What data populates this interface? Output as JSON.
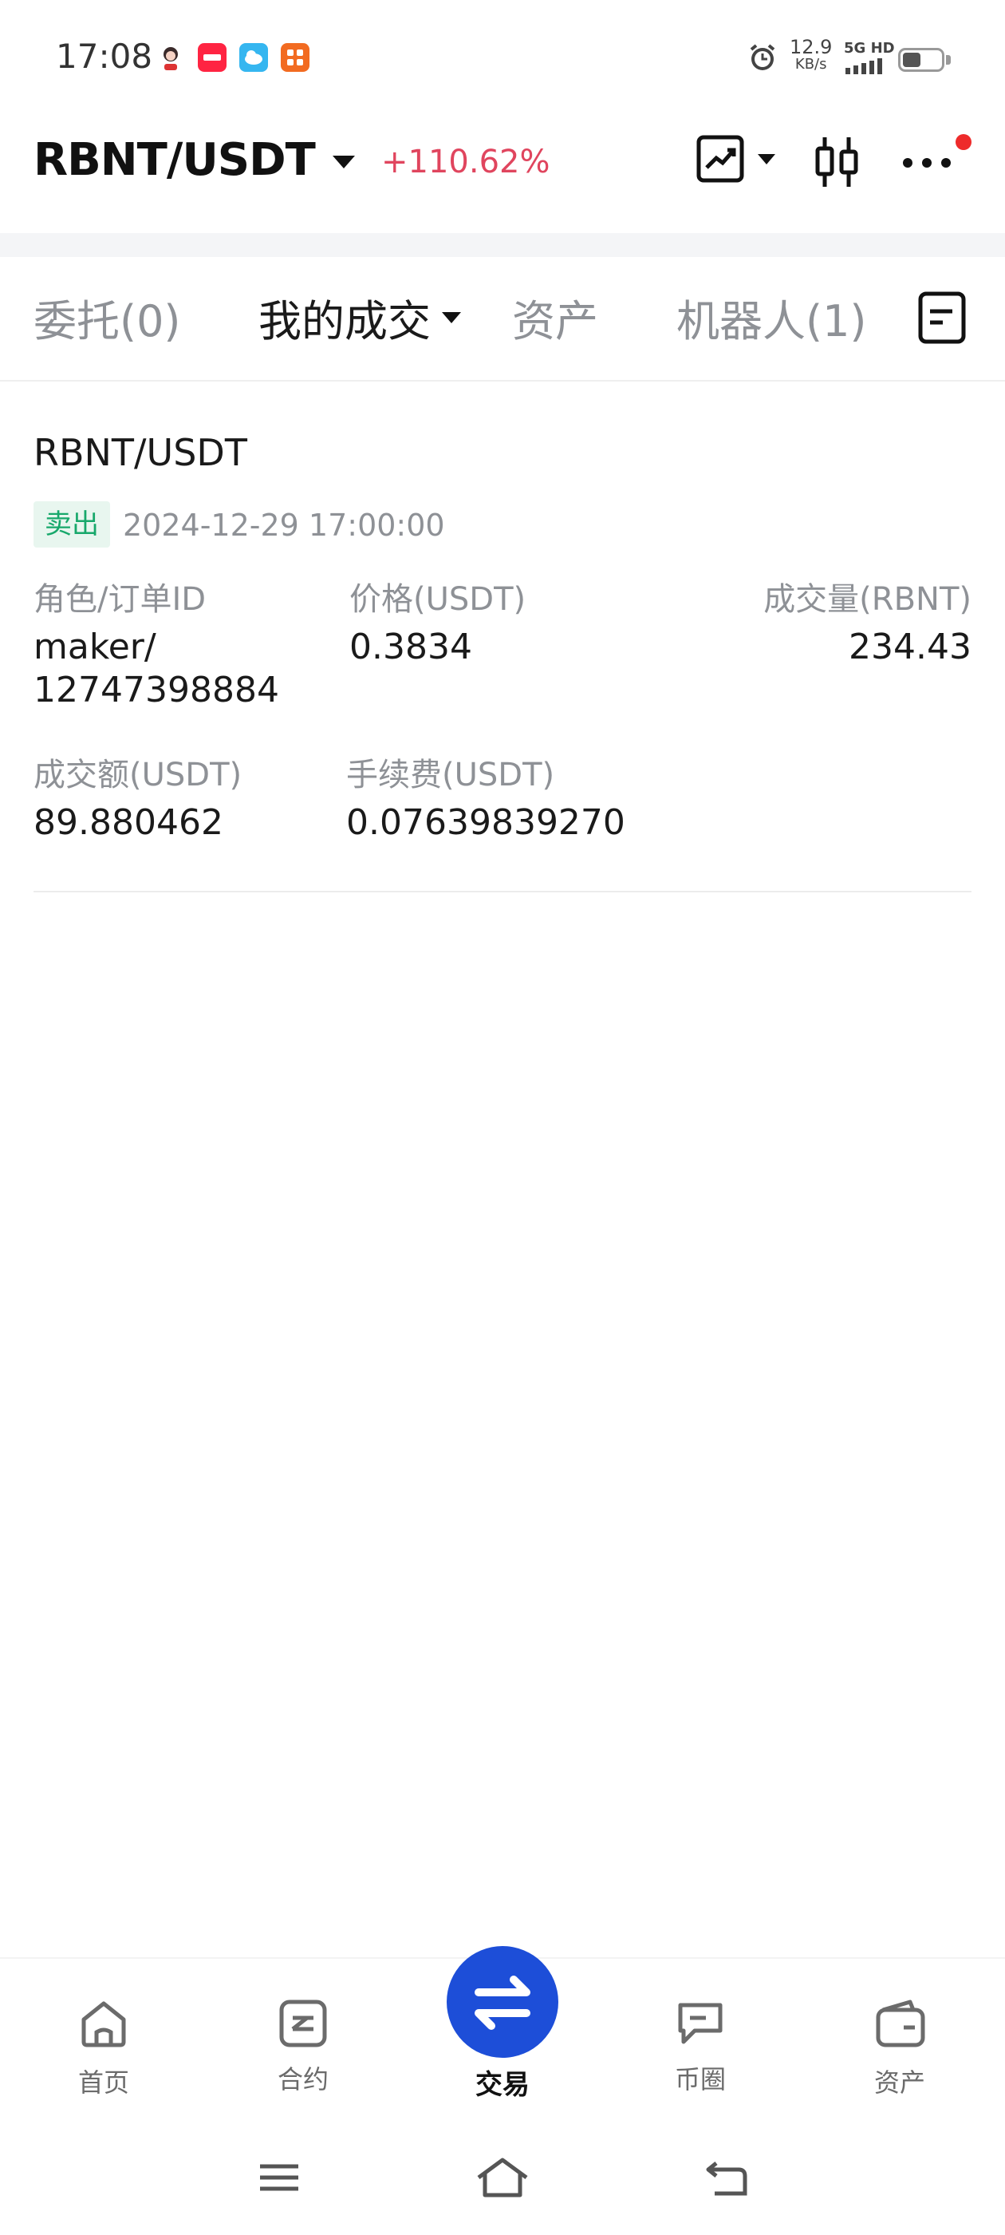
{
  "status_bar": {
    "time": "17:08",
    "net_speed_value": "12.9",
    "net_speed_unit": "KB/s",
    "network": "5G HD"
  },
  "header": {
    "pair": "RBNT/USDT",
    "change": "+110.62%"
  },
  "tabs": [
    {
      "label": "委托(0)",
      "active": false
    },
    {
      "label": "我的成交",
      "active": true
    },
    {
      "label": "资产",
      "active": false
    },
    {
      "label": "机器人(1)",
      "active": false
    }
  ],
  "trade": {
    "pair": "RBNT/USDT",
    "side": "卖出",
    "datetime": "2024-12-29 17:00:00",
    "role_label": "角色/订单ID",
    "role_value_line1": "maker/",
    "role_value_line2": "12747398884",
    "price_label": "价格(USDT)",
    "price_value": "0.3834",
    "volume_label": "成交量(RBNT)",
    "volume_value": "234.43",
    "amount_label": "成交额(USDT)",
    "amount_value": "89.880462",
    "fee_label": "手续费(USDT)",
    "fee_value": "0.07639839270"
  },
  "bottom_nav": [
    {
      "label": "首页",
      "icon": "home-icon"
    },
    {
      "label": "合约",
      "icon": "contract-icon"
    },
    {
      "label": "交易",
      "icon": "swap-icon",
      "active": true
    },
    {
      "label": "币圈",
      "icon": "chat-icon"
    },
    {
      "label": "资产",
      "icon": "wallet-icon"
    }
  ],
  "colors": {
    "up": "#e0455e",
    "sell_badge_text": "#17a86b",
    "sell_badge_bg": "#e8f6ef",
    "primary": "#1d4ed8",
    "notification_dot": "#ee2b2b"
  }
}
